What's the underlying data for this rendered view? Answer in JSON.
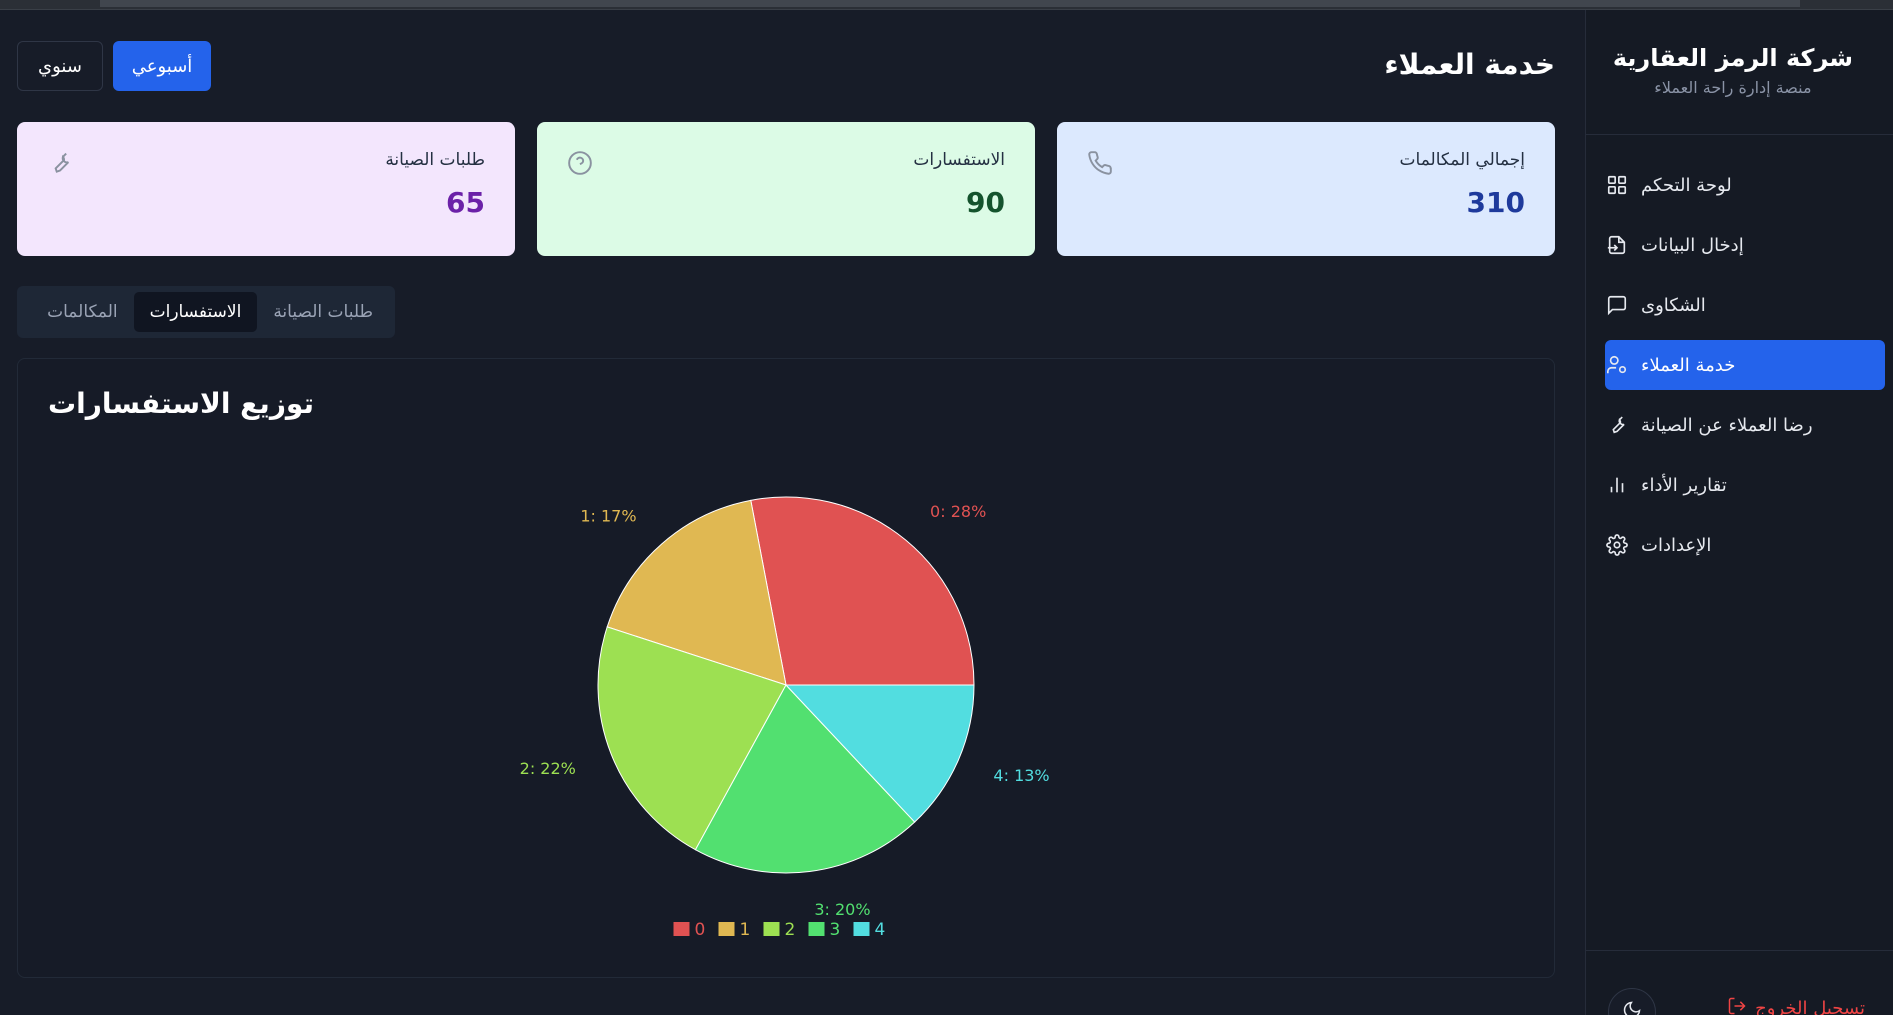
{
  "sidebar": {
    "brand_title": "شركة الرمز العقارية",
    "brand_subtitle": "منصة إدارة راحة العملاء",
    "items": [
      {
        "label": "لوحة التحكم",
        "icon": "dashboard-icon",
        "active": false
      },
      {
        "label": "إدخال البيانات",
        "icon": "file-input-icon",
        "active": false
      },
      {
        "label": "الشكاوى",
        "icon": "message-icon",
        "active": false
      },
      {
        "label": "خدمة العملاء",
        "icon": "user-cog-icon",
        "active": true
      },
      {
        "label": "رضا العملاء عن الصيانة",
        "icon": "wrench-icon",
        "active": false
      },
      {
        "label": "تقارير الأداء",
        "icon": "bar-chart-icon",
        "active": false
      },
      {
        "label": "الإعدادات",
        "icon": "gear-icon",
        "active": false
      }
    ],
    "logout_label": "تسجيل الخروج",
    "theme_icon": "moon-icon"
  },
  "header": {
    "title": "خدمة العملاء",
    "period_weekly": "أسبوعي",
    "period_annual": "سنوي",
    "active_period": "weekly"
  },
  "stats": {
    "calls": {
      "label": "إجمالي المكالمات",
      "value": "310",
      "icon": "phone-icon"
    },
    "inquiries": {
      "label": "الاستفسارات",
      "value": "90",
      "icon": "help-circle-icon"
    },
    "maintenance": {
      "label": "طلبات الصيانة",
      "value": "65",
      "icon": "wrench-icon"
    }
  },
  "tabs": [
    {
      "label": "المكالمات",
      "active": false
    },
    {
      "label": "الاستفسارات",
      "active": true
    },
    {
      "label": "طلبات الصيانة",
      "active": false
    }
  ],
  "chart": {
    "title": "توزيع الاستفسارات"
  },
  "chart_data": {
    "type": "pie",
    "title": "توزيع الاستفسارات",
    "categories": [
      "0",
      "1",
      "2",
      "3",
      "4"
    ],
    "values": [
      28,
      17,
      22,
      20,
      13
    ],
    "labels": [
      "0: 28%",
      "1: 17%",
      "2: 22%",
      "3: 20%",
      "4: 13%"
    ],
    "colors": [
      "#e05252",
      "#e0b852",
      "#9de052",
      "#52e070",
      "#52dde0"
    ],
    "legend": "bottom"
  }
}
